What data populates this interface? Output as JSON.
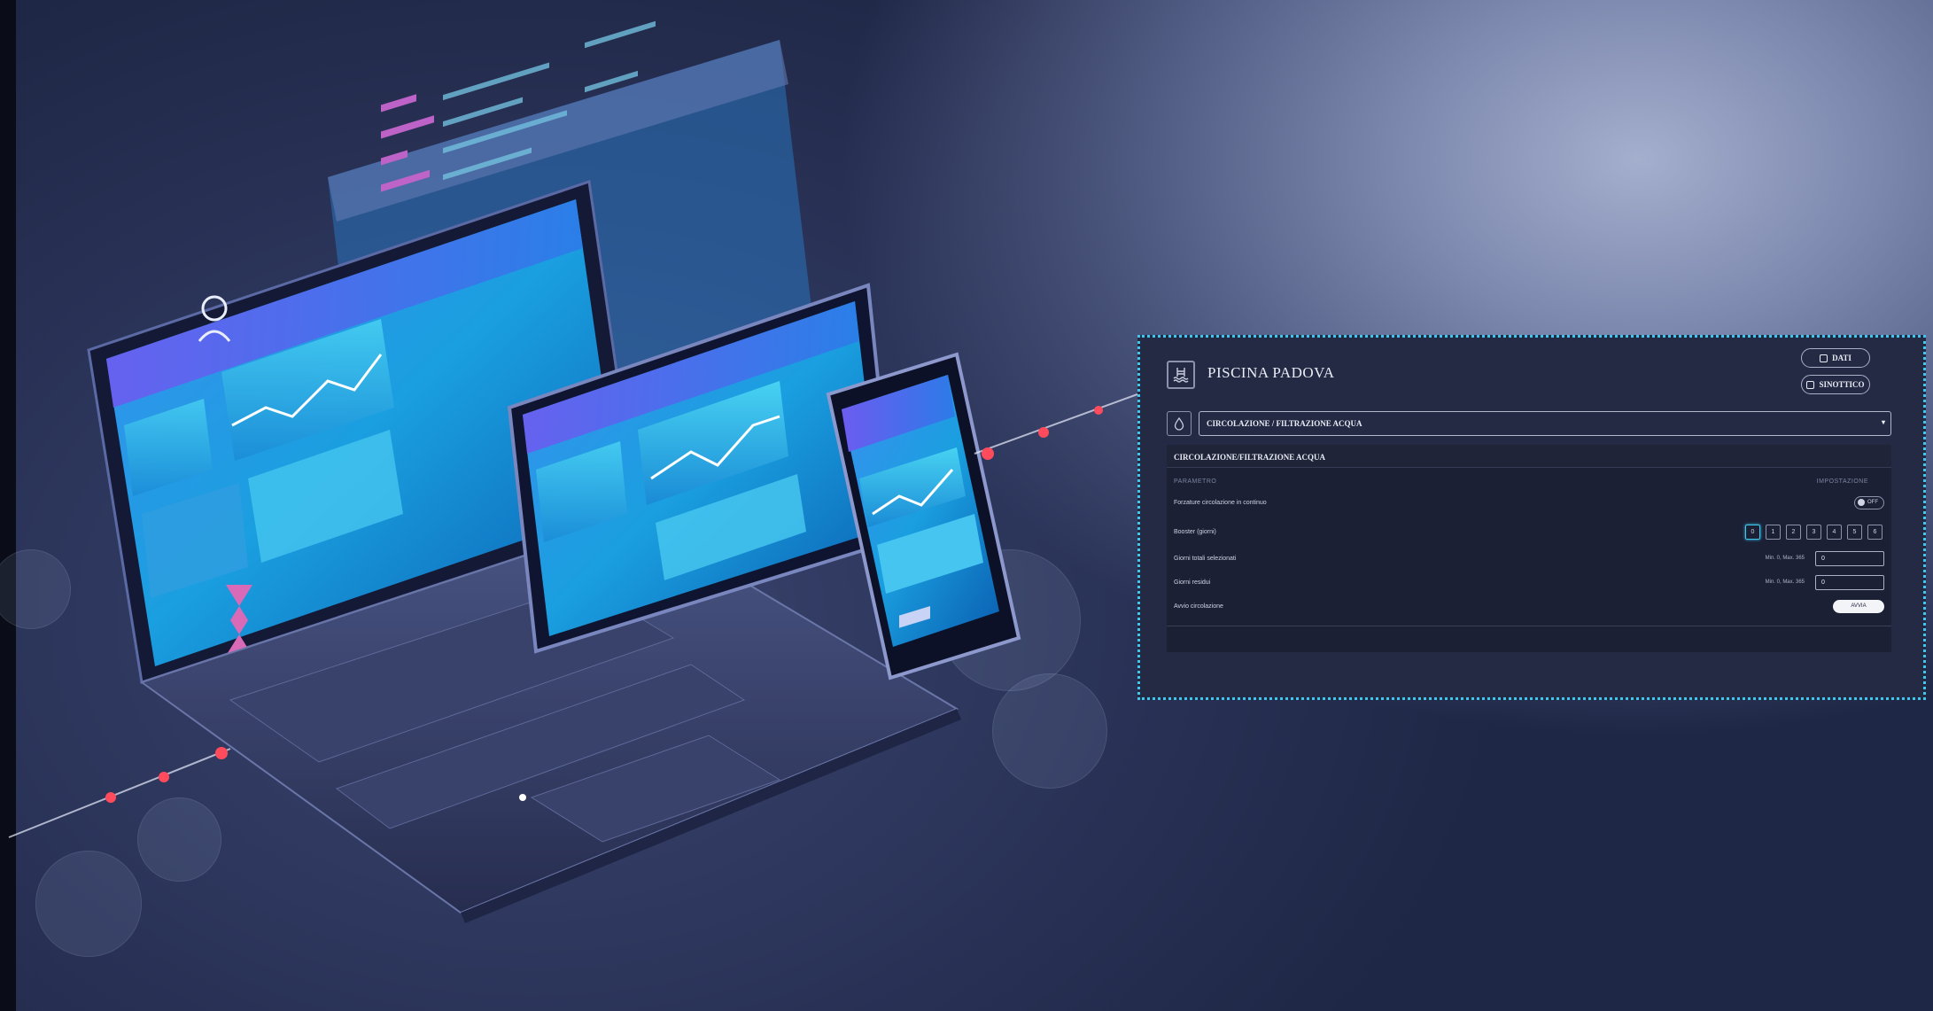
{
  "header": {
    "title": "PISCINA PADOVA",
    "buttons": {
      "dati": "DATI",
      "sinottico": "SINOTTICO"
    }
  },
  "section_select": {
    "value": "CIRCOLAZIONE / FILTRAZIONE ACQUA"
  },
  "card": {
    "title": "CIRCOLAZIONE/FILTRAZIONE ACQUA",
    "col_param": "PARAMETRO",
    "col_setting": "IMPOSTAZIONE",
    "rows": {
      "forzatura": {
        "label": "Forzature circolazione in continuo",
        "toggle": "OFF"
      },
      "booster": {
        "label": "Booster (giorni)",
        "days": [
          "0",
          "1",
          "2",
          "3",
          "4",
          "5",
          "6"
        ],
        "selected": "0"
      },
      "giorni_totali": {
        "label": "Giorni totali selezionati",
        "range": "Min. 0, Max. 365",
        "value": "0"
      },
      "giorni_residui": {
        "label": "Giorni residui",
        "range": "Min. 0, Max. 365",
        "value": "0"
      },
      "avvio": {
        "label": "Avvio circolazione",
        "button": "AVVIA"
      }
    }
  },
  "colors": {
    "accent": "#3ec8ee",
    "panel_bg": "#242a44",
    "card_bg": "#1b2035"
  },
  "icons": [
    "pool-icon",
    "water-drop-icon",
    "check-square-icon",
    "list-icon",
    "caret-down-icon",
    "user-icon"
  ]
}
